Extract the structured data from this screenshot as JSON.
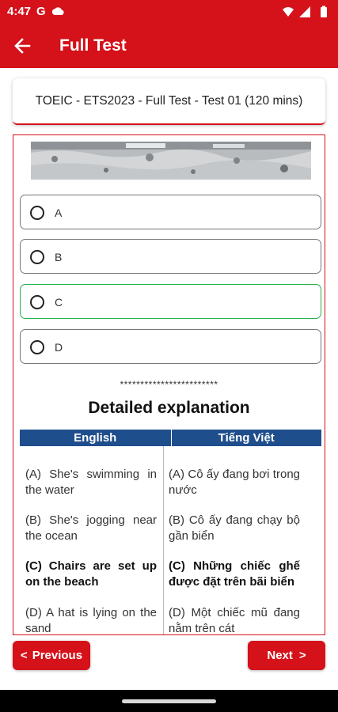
{
  "status_bar": {
    "time": "4:47",
    "g_label": "G"
  },
  "app_bar": {
    "title": "Full Test"
  },
  "test": {
    "title": "TOEIC - ETS2023 - Full Test - Test 01 (120 mins)"
  },
  "options": [
    {
      "label": "A",
      "state": "default"
    },
    {
      "label": "B",
      "state": "default"
    },
    {
      "label": "C",
      "state": "correct"
    },
    {
      "label": "D",
      "state": "default"
    }
  ],
  "explanation": {
    "separator": "************************",
    "title": "Detailed explanation",
    "headers": {
      "english": "English",
      "vietnamese": "Tiếng Việt"
    },
    "rows": [
      {
        "en": "(A) She's swimming in the water",
        "vi": "(A) Cô ấy đang bơi trong nước",
        "bold": false
      },
      {
        "en": "(B) She's jogging near the ocean",
        "vi": "(B) Cô ấy đang chạy bộ gần biển",
        "bold": false
      },
      {
        "en": "(C) Chairs are set up on the beach",
        "vi": "(C) Những chiếc ghế được đặt trên bãi biển",
        "bold": true
      },
      {
        "en": "(D) A hat is lying on the sand",
        "vi": "(D) Một chiếc mũ đang nằm trên cát",
        "bold": false
      }
    ]
  },
  "nav": {
    "previous": "Previous",
    "next": "Next"
  },
  "colors": {
    "primary": "#d5111a",
    "correct": "#22b14c",
    "table_header": "#1f4e8c"
  },
  "icons": [
    "back-arrow-icon",
    "cloud-icon",
    "wifi-icon",
    "signal-icon",
    "battery-icon",
    "chevron-left-icon",
    "chevron-right-icon"
  ]
}
